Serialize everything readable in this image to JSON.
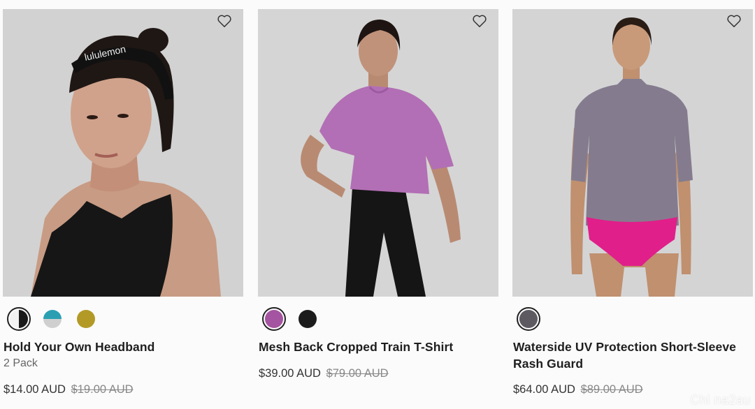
{
  "products": [
    {
      "name": "Hold Your Own Headband",
      "subtitle": "2 Pack",
      "price": "$14.00 AUD",
      "was_price": "$19.00 AUD",
      "headband_text": "lululemon",
      "swatches": [
        "#ffffff/#1a1a1a",
        "#2a9fb2/#cfcfcf",
        "#b39a26"
      ]
    },
    {
      "name": "Mesh Back Cropped Train T-Shirt",
      "subtitle": "",
      "price": "$39.00 AUD",
      "was_price": "$79.00 AUD",
      "swatches": [
        "#a454a0",
        "#1c1c1c"
      ]
    },
    {
      "name": "Waterside UV Protection Short-Sleeve Rash Guard",
      "subtitle": "",
      "price": "$64.00 AUD",
      "was_price": "$89.00 AUD",
      "swatches": [
        "#5e5a62"
      ]
    }
  ],
  "watermark": "Chi na2au"
}
